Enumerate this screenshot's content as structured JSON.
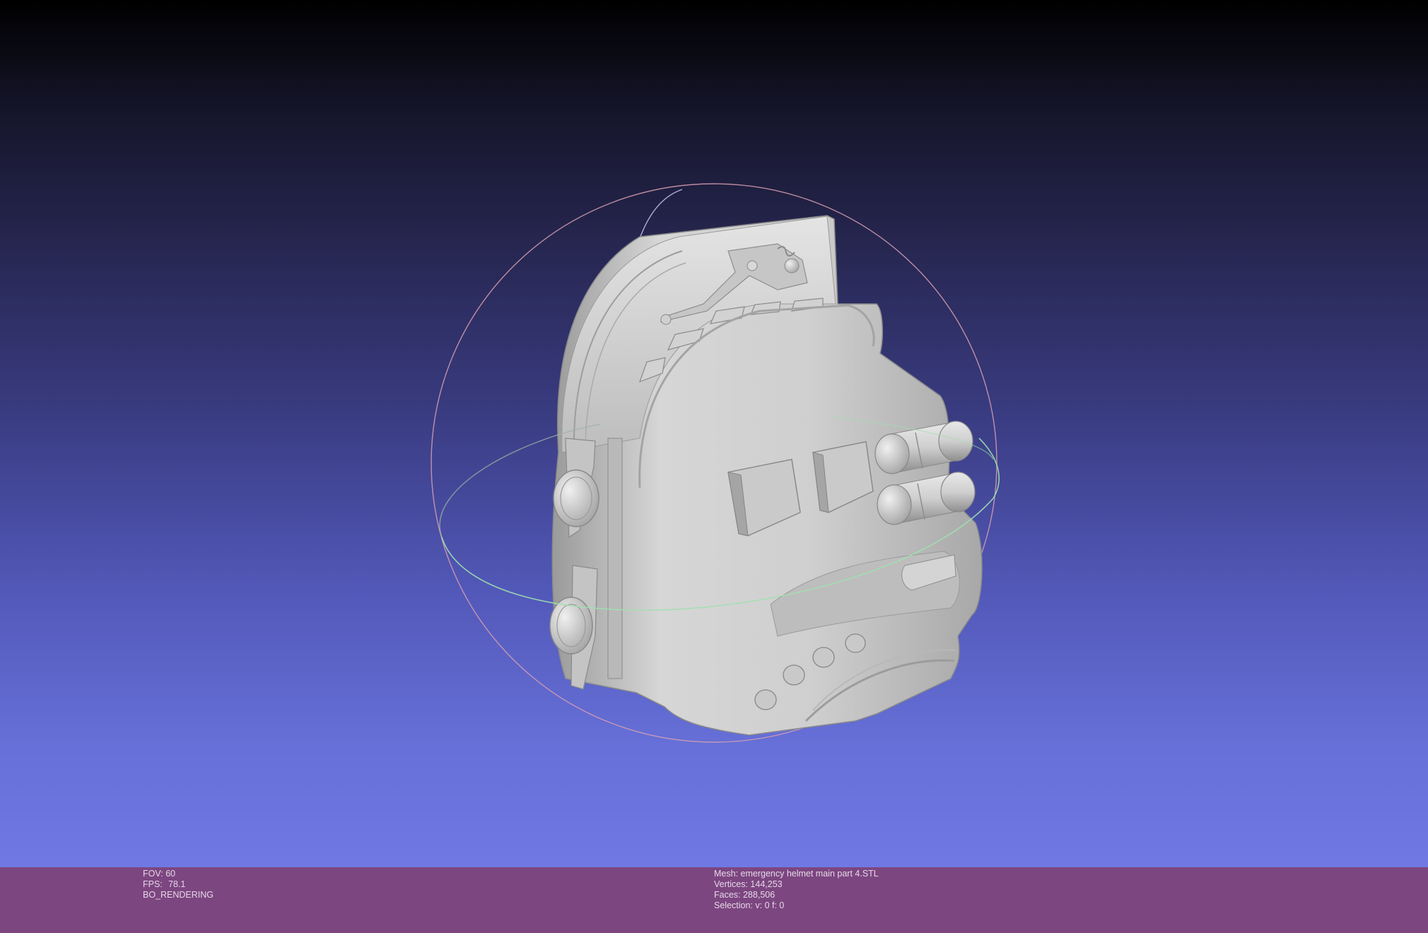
{
  "viewport": {
    "model_name": "emergency helmet main part 4"
  },
  "status_left": {
    "fov_label": "FOV:",
    "fov_value": "60",
    "fps_label": "FPS:",
    "fps_value": "78.1",
    "render_mode": "BO_RENDERING"
  },
  "status_right": {
    "mesh_line": "Mesh: emergency helmet main part 4.STL",
    "vertices_line": "Vertices: 144,253",
    "faces_line": "Faces: 288,506",
    "selection_line": "Selection: v: 0 f: 0"
  },
  "colors": {
    "status_bar": "#7c4680",
    "status_text": "#e6d8e8",
    "trackball_red": "#d8a0b0",
    "trackball_green": "#a0e0b0",
    "trackball_blue": "#c0c0f0",
    "mesh": "#c8c8c8"
  }
}
